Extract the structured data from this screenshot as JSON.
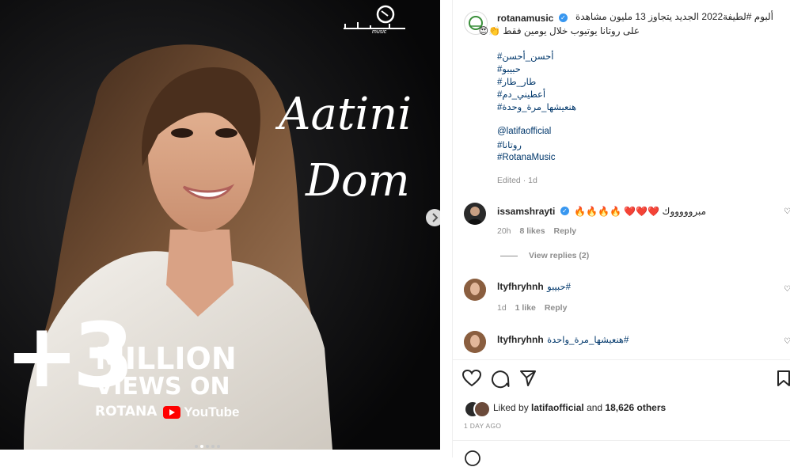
{
  "post": {
    "image": {
      "brand_logo_text": "music",
      "title_line1": "Aatini",
      "title_line2": "Dom",
      "views_plus": "+3",
      "views_line1": "MILLION",
      "views_line2": "VIEWS ON",
      "views_line3": "ROTANA",
      "youtube_label": "YouTube",
      "carousel_dots": 5,
      "active_dot": 1
    },
    "caption": {
      "username": "rotanamusic",
      "line1": "ألبوم #لطيفة2022 الجديد يتجاوز 13 مليون مشاهدة",
      "line2": "على روتانا يوتيوب خلال يومين فقط 👏😍",
      "hashtags": [
        "#أحسن_أحسن",
        "#حبيبو",
        "#طار_طار",
        "#أعطيني_دم",
        "#هنعيشها_مرة_وحدة"
      ],
      "mentions": [
        "@latifaofficial",
        "#روتانا",
        "#RotanaMusic"
      ],
      "meta": "Edited · 1d"
    },
    "comments": [
      {
        "username": "issamshrayti",
        "text": "مبروووووك ❤️❤️❤️ 🔥🔥🔥🔥",
        "time": "20h",
        "likes": "8 likes",
        "reply": "Reply",
        "view_replies": "View replies (2)"
      },
      {
        "username": "ltyfhryhnh",
        "text": "#حبيبو",
        "time": "1d",
        "likes": "1 like",
        "reply": "Reply"
      },
      {
        "username": "ltyfhryhnh",
        "text": "#هنعيشها_مرة_واحدة"
      }
    ],
    "likes": {
      "prefix": "Liked by",
      "user": "latifaofficial",
      "middle": "and",
      "others": "18,626 others"
    },
    "timestamp": "1 DAY AGO"
  },
  "colors": {
    "link": "#00376b",
    "verified": "#3897f0",
    "muted": "#8e8e8e",
    "youtube_red": "#ff0000"
  }
}
